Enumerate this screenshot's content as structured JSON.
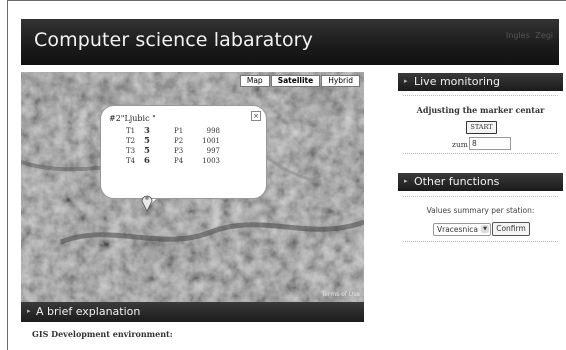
{
  "header": {
    "title": "Computer science labaratory",
    "lang_links": [
      "Ingles",
      "Zegi"
    ]
  },
  "map": {
    "types": [
      "Map",
      "Satellite",
      "Hybrid"
    ],
    "active_type": "Satellite",
    "terms": "Terms of Use",
    "info": {
      "title": "#2\"Ljubic \"",
      "rows": [
        {
          "t_label": "T1",
          "t_value": "3",
          "p_label": "P1",
          "p_value": "998"
        },
        {
          "t_label": "T2",
          "t_value": "5",
          "p_label": "P2",
          "p_value": "1001"
        },
        {
          "t_label": "T3",
          "t_value": "5",
          "p_label": "P3",
          "p_value": "997"
        },
        {
          "t_label": "T4",
          "t_value": "6",
          "p_label": "P4",
          "p_value": "1003"
        }
      ],
      "close": "×"
    }
  },
  "brief": {
    "title": "A brief explanation",
    "text": "GIS Development environment:"
  },
  "live": {
    "title": "Live monitoring",
    "subtitle": "Adjusting the marker centar",
    "start_label": "START",
    "zum_label": "zum",
    "zum_value": "8"
  },
  "other": {
    "title": "Other functions",
    "values_label": "Values summary per station:",
    "station_value": "Vracesnica",
    "confirm_label": "Confirm"
  },
  "icons": {
    "panel_arrow": "chevron-right-icon",
    "marker": "map-marker-icon"
  }
}
